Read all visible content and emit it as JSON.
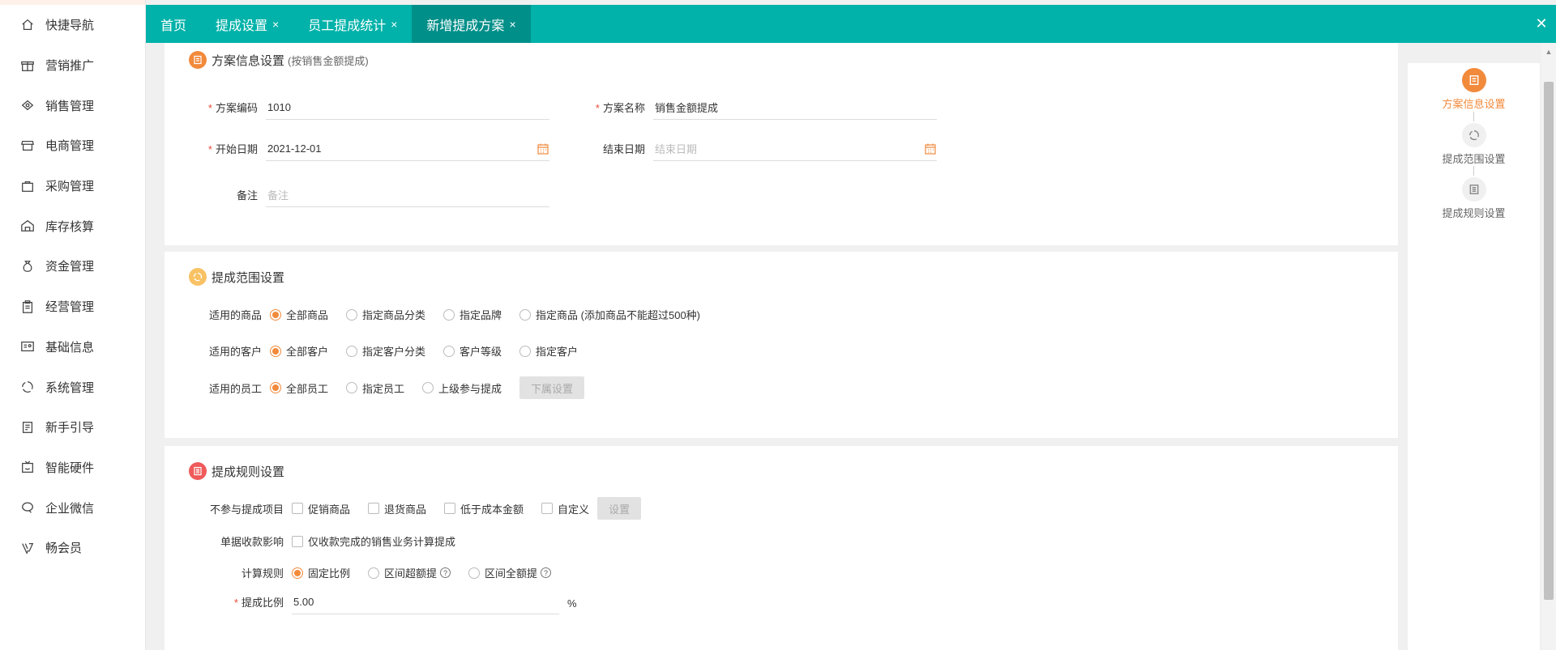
{
  "sidebar": {
    "items": [
      {
        "label": "快捷导航",
        "icon": "home-icon"
      },
      {
        "label": "营销推广",
        "icon": "gift-icon"
      },
      {
        "label": "销售管理",
        "icon": "sales-icon"
      },
      {
        "label": "电商管理",
        "icon": "store-icon"
      },
      {
        "label": "采购管理",
        "icon": "bag-icon"
      },
      {
        "label": "库存核算",
        "icon": "warehouse-icon"
      },
      {
        "label": "资金管理",
        "icon": "money-bag-icon"
      },
      {
        "label": "经营管理",
        "icon": "clipboard-icon"
      },
      {
        "label": "基础信息",
        "icon": "id-card-icon"
      },
      {
        "label": "系统管理",
        "icon": "cycle-icon"
      },
      {
        "label": "新手引导",
        "icon": "guide-icon"
      },
      {
        "label": "智能硬件",
        "icon": "tv-icon"
      },
      {
        "label": "企业微信",
        "icon": "chat-icon"
      },
      {
        "label": "畅会员",
        "icon": "vip-icon"
      }
    ]
  },
  "tabs": [
    {
      "label": "首页",
      "closable": false,
      "active": false
    },
    {
      "label": "提成设置",
      "closable": true,
      "active": false
    },
    {
      "label": "员工提成统计",
      "closable": true,
      "active": false
    },
    {
      "label": "新增提成方案",
      "closable": true,
      "active": true
    }
  ],
  "tab_close_glyph": "×",
  "close_all_glyph": "✕",
  "section1": {
    "title": "方案信息设置",
    "subtitle": "(按销售金额提成)",
    "code_label": "方案编码",
    "code_value": "1010",
    "name_label": "方案名称",
    "name_value": "销售金额提成",
    "start_label": "开始日期",
    "start_value": "2021-12-01",
    "end_label": "结束日期",
    "end_placeholder": "结束日期",
    "remark_label": "备注",
    "remark_placeholder": "备注",
    "required_mark": "*"
  },
  "section2": {
    "title": "提成范围设置",
    "goods_label": "适用的商品",
    "goods_options": [
      "全部商品",
      "指定商品分类",
      "指定品牌",
      "指定商品 (添加商品不能超过500种)"
    ],
    "customer_label": "适用的客户",
    "customer_options": [
      "全部客户",
      "指定客户分类",
      "客户等级",
      "指定客户"
    ],
    "staff_label": "适用的员工",
    "staff_options": [
      "全部员工",
      "指定员工",
      "上级参与提成"
    ],
    "sub_button": "下属设置"
  },
  "section3": {
    "title": "提成规则设置",
    "exclude_label": "不参与提成项目",
    "exclude_options": [
      "促销商品",
      "退货商品",
      "低于成本金额",
      "自定义"
    ],
    "set_button": "设置",
    "receipt_label": "单据收款影响",
    "receipt_option": "仅收款完成的销售业务计算提成",
    "rule_label": "计算规则",
    "rule_options": [
      "固定比例",
      "区间超额提",
      "区间全额提"
    ],
    "help_glyph": "?",
    "ratio_label": "提成比例",
    "ratio_value": "5.00",
    "ratio_unit": "%"
  },
  "steps": [
    {
      "label": "方案信息设置",
      "active": true
    },
    {
      "label": "提成范围设置",
      "active": false
    },
    {
      "label": "提成规则设置",
      "active": false
    }
  ],
  "colors": {
    "accent": "#00b2a9",
    "orange": "#f28a3c",
    "required": "#e94b3c"
  }
}
